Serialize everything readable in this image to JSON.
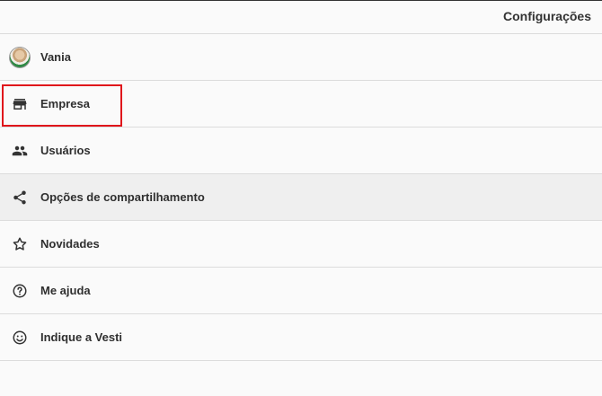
{
  "header": {
    "title": "Configurações"
  },
  "menu": {
    "items": [
      {
        "label": "Vania",
        "icon": "avatar"
      },
      {
        "label": "Empresa",
        "icon": "store-icon"
      },
      {
        "label": "Usuários",
        "icon": "users-icon"
      },
      {
        "label": "Opções de compartilhamento",
        "icon": "share-icon"
      },
      {
        "label": "Novidades",
        "icon": "star-icon"
      },
      {
        "label": "Me ajuda",
        "icon": "help-icon"
      },
      {
        "label": "Indique a Vesti",
        "icon": "smile-icon"
      }
    ]
  },
  "colors": {
    "highlight": "#e0151b",
    "active_row": "#efefef",
    "divider": "#dcdcdc"
  }
}
